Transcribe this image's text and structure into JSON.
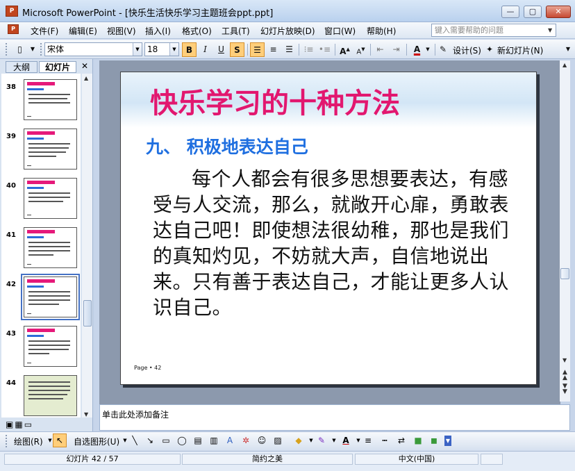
{
  "window": {
    "app_icon_label": "P",
    "title": "Microsoft PowerPoint - [快乐生活快乐学习主题班会ppt.ppt]",
    "min_label": "—",
    "max_label": "▢",
    "close_label": "✕"
  },
  "menu": {
    "items": [
      "文件(F)",
      "编辑(E)",
      "视图(V)",
      "插入(I)",
      "格式(O)",
      "工具(T)",
      "幻灯片放映(D)",
      "窗口(W)",
      "帮助(H)"
    ],
    "help_placeholder": "键入需要帮助的问题"
  },
  "toolbar": {
    "font_name": "宋体",
    "font_size": "18",
    "bold_label": "B",
    "italic_label": "I",
    "underline_label": "U",
    "shadow_label": "S",
    "design_label": "设计(S)",
    "new_slide_label": "新幻灯片(N)"
  },
  "outline_pane": {
    "tabs": [
      "大纲",
      "幻灯片"
    ],
    "close_label": "✕",
    "slides": [
      {
        "number": "38"
      },
      {
        "number": "39"
      },
      {
        "number": "40"
      },
      {
        "number": "41"
      },
      {
        "number": "42"
      },
      {
        "number": "43"
      },
      {
        "number": "44"
      }
    ]
  },
  "slide": {
    "title": "快乐学习的十种方法",
    "subtitle": "九、 积极地表达自己",
    "body": "每个人都会有很多思想要表达，有感受与人交流，那么，就敞开心扉，勇敢表达自己吧！即使想法很幼稚，那也是我们的真知灼见，不妨就大声，自信地说出来。只有善于表达自己，才能让更多人认识自己。",
    "page": "Page • 42",
    "title_color": "#e2176f",
    "subtitle_color": "#1f6fe0"
  },
  "notes": {
    "placeholder": "单击此处添加备注"
  },
  "drawbar": {
    "draw_label": "绘图(R)",
    "autoshape_label": "自选图形(U)"
  },
  "status": {
    "slide_info": "幻灯片 42 / 57",
    "design": "简约之美",
    "language": "中文(中国)"
  }
}
